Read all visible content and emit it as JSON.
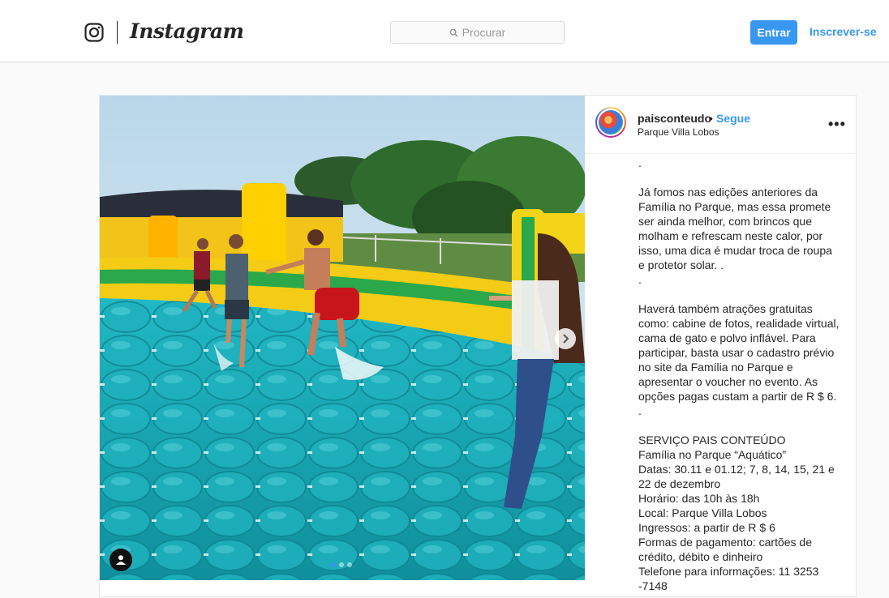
{
  "topbar": {
    "brand": "Instagram",
    "search_placeholder": "Procurar",
    "login_label": "Entrar",
    "signup_label": "Inscrever-se"
  },
  "post": {
    "username": "paisconteudo",
    "separator": "•",
    "follow_label": "Segue",
    "location": "Parque Villa Lobos",
    "more_label": "•••",
    "carousel": {
      "total": 3,
      "active": 1
    },
    "caption": ".\n\nJá fomos nas edições anteriores da Família no Parque, mas essa promete ser ainda melhor, com brincos que molham e refrescam neste calor, por isso, uma dica é mudar troca de roupa e protetor solar. .\n.\n\nHaverá também atrações gratuitas como: cabine de fotos, realidade virtual, cama de gato e polvo inflável. Para participar, basta usar o cadastro prévio no site da Família no Parque e apresentar o voucher no evento. As opções pagas custam a partir de R $ 6.\n.\n\nSERVIÇO PAIS CONTEÚDO\nFamília no Parque “Aquático”\nDatas: 30.11 e 01.12; 7, 8, 14, 15, 21 e 22 de dezembro\nHorário: das 10h às 18h\nLocal: Parque Villa Lobos\nIngressos: a partir de R $ 6\nFormas de pagamento: cartões de crédito, débito e dinheiro\nTelefone para informações: 11 3253 -7148"
  },
  "colors": {
    "accent": "#3897f0",
    "border": "#dbdbdb",
    "text": "#262626"
  }
}
